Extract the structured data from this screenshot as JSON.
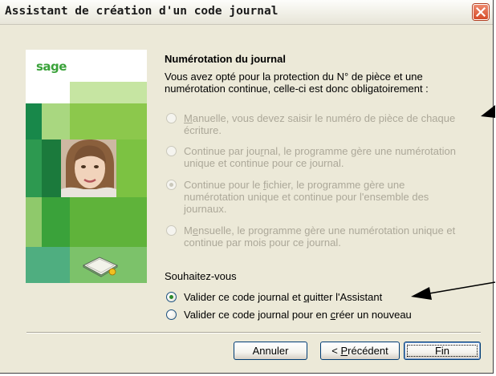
{
  "window": {
    "title": "Assistant de création d'un code journal"
  },
  "sidebar": {
    "logo": "sage"
  },
  "content": {
    "heading": "Numérotation du journal",
    "intro_line1": "Vous avez opté pour la protection du N° de pièce et une",
    "intro_line2": "numérotation continue, celle-ci est donc obligatoirement :",
    "numbering_options": [
      {
        "mnemonic": "M",
        "line1_rest": "anuelle, vous devez saisir le numéro de pièce de chaque",
        "line2": "écriture.",
        "selected": false,
        "enabled": false
      },
      {
        "line1_a": "Continue par jou",
        "mnemonic": "r",
        "line1_b": "nal, le programme gère une numérotation",
        "line2": "unique et continue pour ce journal.",
        "selected": false,
        "enabled": false
      },
      {
        "line1_a": "Continue pour le ",
        "mnemonic": "f",
        "line1_b": "ichier, le programme gère une",
        "line2": "numérotation unique et continue pour l'ensemble des",
        "line3": "journaux.",
        "selected": true,
        "enabled": false
      },
      {
        "line1_a": "M",
        "mnemonic": "e",
        "line1_b": "nsuelle, le programme gère une numérotation unique et",
        "line2": "continue par mois pour ce journal.",
        "selected": false,
        "enabled": false
      }
    ],
    "question": "Souhaitez-vous",
    "actions": [
      {
        "text_a": "Valider ce code journal et ",
        "mnemonic": "q",
        "text_b": "uitter l'Assistant",
        "selected": true
      },
      {
        "text_a": "Valider ce code journal pour en ",
        "mnemonic": "c",
        "text_b": "réer un nouveau",
        "selected": false
      }
    ]
  },
  "buttons": {
    "cancel": "Annuler",
    "prev_prefix": "< ",
    "prev_mnemonic": "P",
    "prev_rest": "récédent",
    "finish": "Fin"
  },
  "colors": {
    "dialog_bg": "#ece9d8",
    "disabled_text": "#aca899",
    "sage_green": "#3aa23a",
    "close_button": "#d64c2a"
  }
}
